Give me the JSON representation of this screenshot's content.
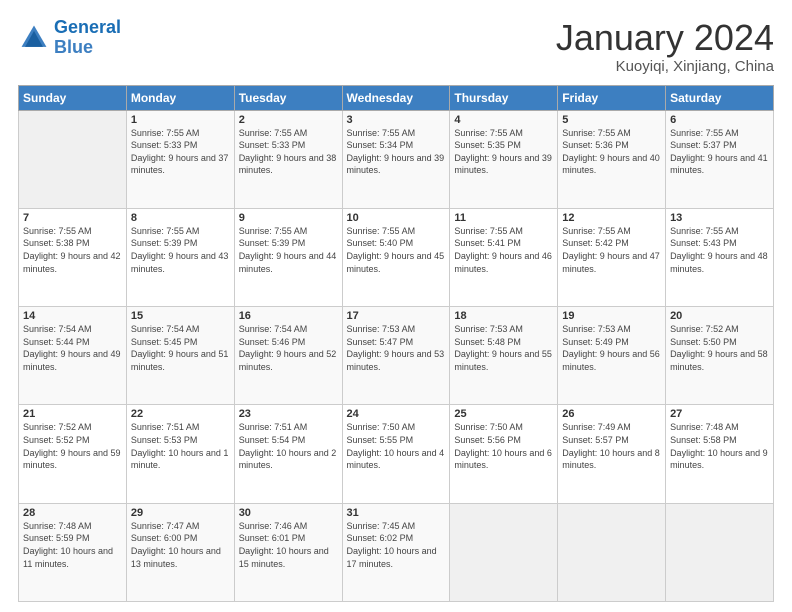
{
  "header": {
    "logo_general": "General",
    "logo_blue": "Blue",
    "title": "January 2024",
    "subtitle": "Kuoyiqi, Xinjiang, China"
  },
  "calendar": {
    "headers": [
      "Sunday",
      "Monday",
      "Tuesday",
      "Wednesday",
      "Thursday",
      "Friday",
      "Saturday"
    ],
    "weeks": [
      [
        {
          "day": "",
          "sunrise": "",
          "sunset": "",
          "daylight": ""
        },
        {
          "day": "1",
          "sunrise": "Sunrise: 7:55 AM",
          "sunset": "Sunset: 5:33 PM",
          "daylight": "Daylight: 9 hours and 37 minutes."
        },
        {
          "day": "2",
          "sunrise": "Sunrise: 7:55 AM",
          "sunset": "Sunset: 5:33 PM",
          "daylight": "Daylight: 9 hours and 38 minutes."
        },
        {
          "day": "3",
          "sunrise": "Sunrise: 7:55 AM",
          "sunset": "Sunset: 5:34 PM",
          "daylight": "Daylight: 9 hours and 39 minutes."
        },
        {
          "day": "4",
          "sunrise": "Sunrise: 7:55 AM",
          "sunset": "Sunset: 5:35 PM",
          "daylight": "Daylight: 9 hours and 39 minutes."
        },
        {
          "day": "5",
          "sunrise": "Sunrise: 7:55 AM",
          "sunset": "Sunset: 5:36 PM",
          "daylight": "Daylight: 9 hours and 40 minutes."
        },
        {
          "day": "6",
          "sunrise": "Sunrise: 7:55 AM",
          "sunset": "Sunset: 5:37 PM",
          "daylight": "Daylight: 9 hours and 41 minutes."
        }
      ],
      [
        {
          "day": "7",
          "sunrise": "Sunrise: 7:55 AM",
          "sunset": "Sunset: 5:38 PM",
          "daylight": "Daylight: 9 hours and 42 minutes."
        },
        {
          "day": "8",
          "sunrise": "Sunrise: 7:55 AM",
          "sunset": "Sunset: 5:39 PM",
          "daylight": "Daylight: 9 hours and 43 minutes."
        },
        {
          "day": "9",
          "sunrise": "Sunrise: 7:55 AM",
          "sunset": "Sunset: 5:39 PM",
          "daylight": "Daylight: 9 hours and 44 minutes."
        },
        {
          "day": "10",
          "sunrise": "Sunrise: 7:55 AM",
          "sunset": "Sunset: 5:40 PM",
          "daylight": "Daylight: 9 hours and 45 minutes."
        },
        {
          "day": "11",
          "sunrise": "Sunrise: 7:55 AM",
          "sunset": "Sunset: 5:41 PM",
          "daylight": "Daylight: 9 hours and 46 minutes."
        },
        {
          "day": "12",
          "sunrise": "Sunrise: 7:55 AM",
          "sunset": "Sunset: 5:42 PM",
          "daylight": "Daylight: 9 hours and 47 minutes."
        },
        {
          "day": "13",
          "sunrise": "Sunrise: 7:55 AM",
          "sunset": "Sunset: 5:43 PM",
          "daylight": "Daylight: 9 hours and 48 minutes."
        }
      ],
      [
        {
          "day": "14",
          "sunrise": "Sunrise: 7:54 AM",
          "sunset": "Sunset: 5:44 PM",
          "daylight": "Daylight: 9 hours and 49 minutes."
        },
        {
          "day": "15",
          "sunrise": "Sunrise: 7:54 AM",
          "sunset": "Sunset: 5:45 PM",
          "daylight": "Daylight: 9 hours and 51 minutes."
        },
        {
          "day": "16",
          "sunrise": "Sunrise: 7:54 AM",
          "sunset": "Sunset: 5:46 PM",
          "daylight": "Daylight: 9 hours and 52 minutes."
        },
        {
          "day": "17",
          "sunrise": "Sunrise: 7:53 AM",
          "sunset": "Sunset: 5:47 PM",
          "daylight": "Daylight: 9 hours and 53 minutes."
        },
        {
          "day": "18",
          "sunrise": "Sunrise: 7:53 AM",
          "sunset": "Sunset: 5:48 PM",
          "daylight": "Daylight: 9 hours and 55 minutes."
        },
        {
          "day": "19",
          "sunrise": "Sunrise: 7:53 AM",
          "sunset": "Sunset: 5:49 PM",
          "daylight": "Daylight: 9 hours and 56 minutes."
        },
        {
          "day": "20",
          "sunrise": "Sunrise: 7:52 AM",
          "sunset": "Sunset: 5:50 PM",
          "daylight": "Daylight: 9 hours and 58 minutes."
        }
      ],
      [
        {
          "day": "21",
          "sunrise": "Sunrise: 7:52 AM",
          "sunset": "Sunset: 5:52 PM",
          "daylight": "Daylight: 9 hours and 59 minutes."
        },
        {
          "day": "22",
          "sunrise": "Sunrise: 7:51 AM",
          "sunset": "Sunset: 5:53 PM",
          "daylight": "Daylight: 10 hours and 1 minute."
        },
        {
          "day": "23",
          "sunrise": "Sunrise: 7:51 AM",
          "sunset": "Sunset: 5:54 PM",
          "daylight": "Daylight: 10 hours and 2 minutes."
        },
        {
          "day": "24",
          "sunrise": "Sunrise: 7:50 AM",
          "sunset": "Sunset: 5:55 PM",
          "daylight": "Daylight: 10 hours and 4 minutes."
        },
        {
          "day": "25",
          "sunrise": "Sunrise: 7:50 AM",
          "sunset": "Sunset: 5:56 PM",
          "daylight": "Daylight: 10 hours and 6 minutes."
        },
        {
          "day": "26",
          "sunrise": "Sunrise: 7:49 AM",
          "sunset": "Sunset: 5:57 PM",
          "daylight": "Daylight: 10 hours and 8 minutes."
        },
        {
          "day": "27",
          "sunrise": "Sunrise: 7:48 AM",
          "sunset": "Sunset: 5:58 PM",
          "daylight": "Daylight: 10 hours and 9 minutes."
        }
      ],
      [
        {
          "day": "28",
          "sunrise": "Sunrise: 7:48 AM",
          "sunset": "Sunset: 5:59 PM",
          "daylight": "Daylight: 10 hours and 11 minutes."
        },
        {
          "day": "29",
          "sunrise": "Sunrise: 7:47 AM",
          "sunset": "Sunset: 6:00 PM",
          "daylight": "Daylight: 10 hours and 13 minutes."
        },
        {
          "day": "30",
          "sunrise": "Sunrise: 7:46 AM",
          "sunset": "Sunset: 6:01 PM",
          "daylight": "Daylight: 10 hours and 15 minutes."
        },
        {
          "day": "31",
          "sunrise": "Sunrise: 7:45 AM",
          "sunset": "Sunset: 6:02 PM",
          "daylight": "Daylight: 10 hours and 17 minutes."
        },
        {
          "day": "",
          "sunrise": "",
          "sunset": "",
          "daylight": ""
        },
        {
          "day": "",
          "sunrise": "",
          "sunset": "",
          "daylight": ""
        },
        {
          "day": "",
          "sunrise": "",
          "sunset": "",
          "daylight": ""
        }
      ]
    ]
  }
}
